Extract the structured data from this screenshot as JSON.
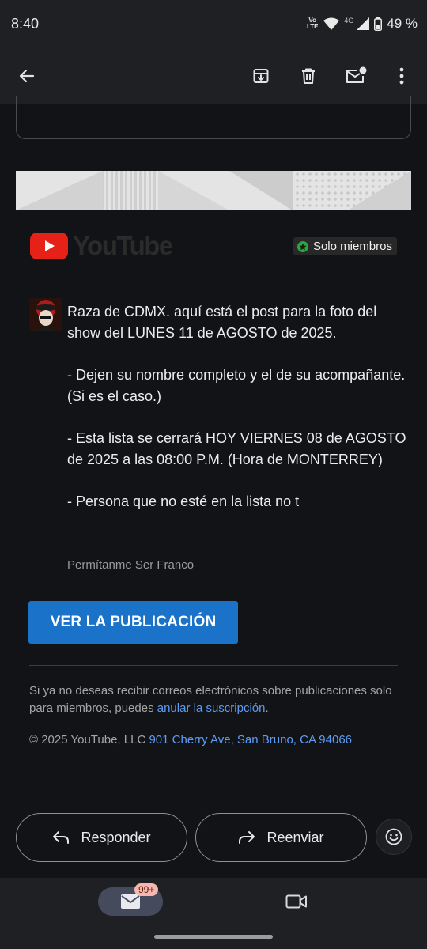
{
  "status": {
    "time": "8:40",
    "volte_top": "Vo",
    "volte_bottom": "LTE",
    "network": "4G",
    "battery": "49 %"
  },
  "app_bar": {
    "back_icon": "arrow-left-icon",
    "archive_icon": "archive-icon",
    "delete_icon": "trash-icon",
    "unread_icon": "mark-unread-icon",
    "more_icon": "more-vertical-icon"
  },
  "email": {
    "brand": "YouTube",
    "members_badge": "Solo miembros",
    "post_paragraphs": [
      "Raza de CDMX. aquí está el post para la foto del show del LUNES 11 de AGOSTO de 2025.",
      "- Dejen su nombre completo y el de su acompañante. (Si es el caso.)",
      "- Esta lista se cerrará HOY VIERNES 08 de AGOSTO de 2025 a las 08:00 P.M. (Hora de MONTERREY)",
      "- Persona que no esté en la lista no t"
    ],
    "author": "Permítanme Ser Franco",
    "cta_label": "VER LA PUBLICACIÓN",
    "unsubscribe_text": "Si ya no deseas recibir correos electrónicos sobre publicaciones solo para miembros, puedes ",
    "unsubscribe_link": "anular la suscripción",
    "unsubscribe_end": ".",
    "footer_text": "© 2025 YouTube, LLC ",
    "footer_link": "901 Cherry Ave, San Bruno, CA 94066"
  },
  "actions": {
    "reply_label": "Responder",
    "forward_label": "Reenviar"
  },
  "bottom_nav": {
    "mail_badge": "99+"
  },
  "colors": {
    "accent_blue": "#1a73c8",
    "link_blue": "#5d9cf5",
    "youtube_red": "#e62117",
    "badge_green": "#2ba640"
  }
}
